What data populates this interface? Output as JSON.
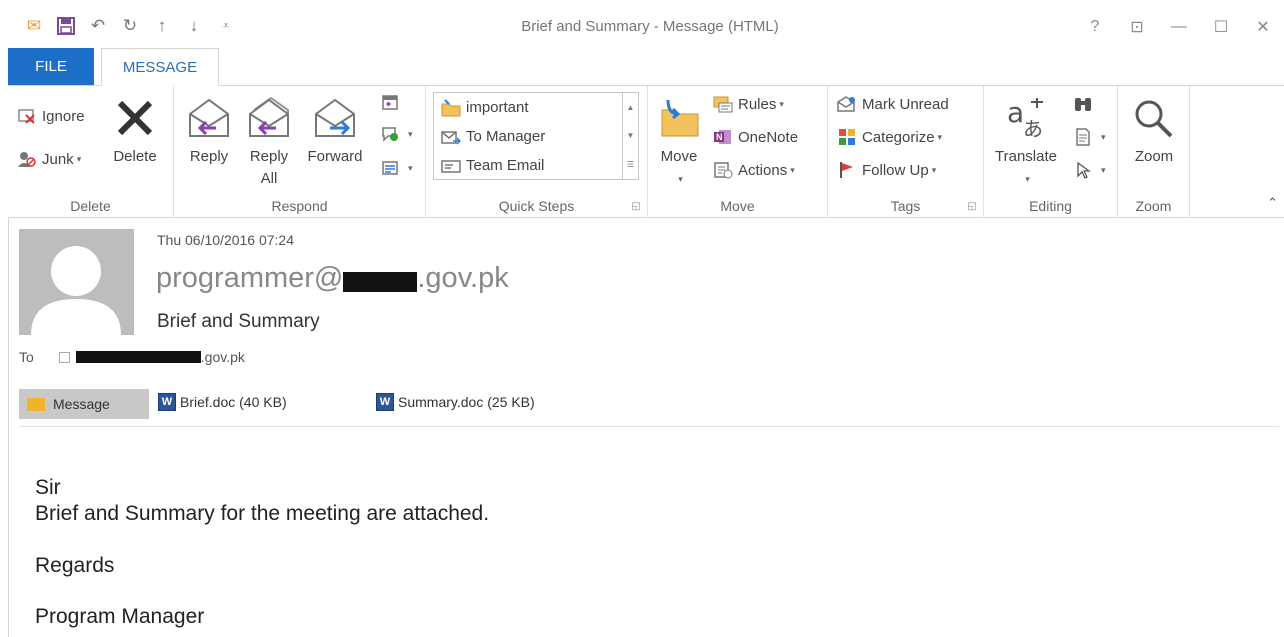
{
  "window": {
    "title": "Brief and Summary - Message (HTML)",
    "help": "?",
    "restore_ribbon": "⊡",
    "minimize": "—",
    "maximize": "☐",
    "close": "✕"
  },
  "qat": {
    "mail": "✉",
    "save": "💾",
    "undo": "↶",
    "redo": "↻",
    "up": "↑",
    "down": "↓",
    "customize": "₹"
  },
  "tabs": {
    "file": "FILE",
    "message": "MESSAGE"
  },
  "ribbon": {
    "delete_group": {
      "label": "Delete",
      "ignore": "Ignore",
      "junk": "Junk",
      "delete": "Delete"
    },
    "respond_group": {
      "label": "Respond",
      "reply": "Reply",
      "reply_all_1": "Reply",
      "reply_all_2": "All",
      "forward": "Forward"
    },
    "quick_steps_group": {
      "label": "Quick Steps",
      "items": [
        "important",
        "To Manager",
        "Team Email"
      ]
    },
    "move_group": {
      "label": "Move",
      "move": "Move",
      "rules": "Rules",
      "onenote": "OneNote",
      "actions": "Actions"
    },
    "tags_group": {
      "label": "Tags",
      "mark_unread": "Mark Unread",
      "categorize": "Categorize",
      "follow_up": "Follow Up"
    },
    "editing_group": {
      "label": "Editing",
      "translate": "Translate"
    },
    "zoom_group": {
      "label": "Zoom",
      "zoom": "Zoom"
    }
  },
  "message": {
    "date": "Thu 06/10/2016 07:24",
    "sender_prefix": "programmer@",
    "sender_suffix": ".gov.pk",
    "subject": "Brief and Summary",
    "to_label": "To",
    "to_suffix": ".gov.pk"
  },
  "attachments": {
    "message_tab": "Message",
    "files": [
      "Brief.doc (40 KB)",
      "Summary.doc (25 KB)"
    ]
  },
  "body": {
    "line1": "Sir",
    "line2": "Brief and Summary for the meeting are attached.",
    "line3": "Regards",
    "line4": "Program Manager"
  },
  "colors": {
    "accent": "#1e6fc8",
    "tab_text": "#2a6db5",
    "attachment_bg": "#c8c8c8"
  }
}
